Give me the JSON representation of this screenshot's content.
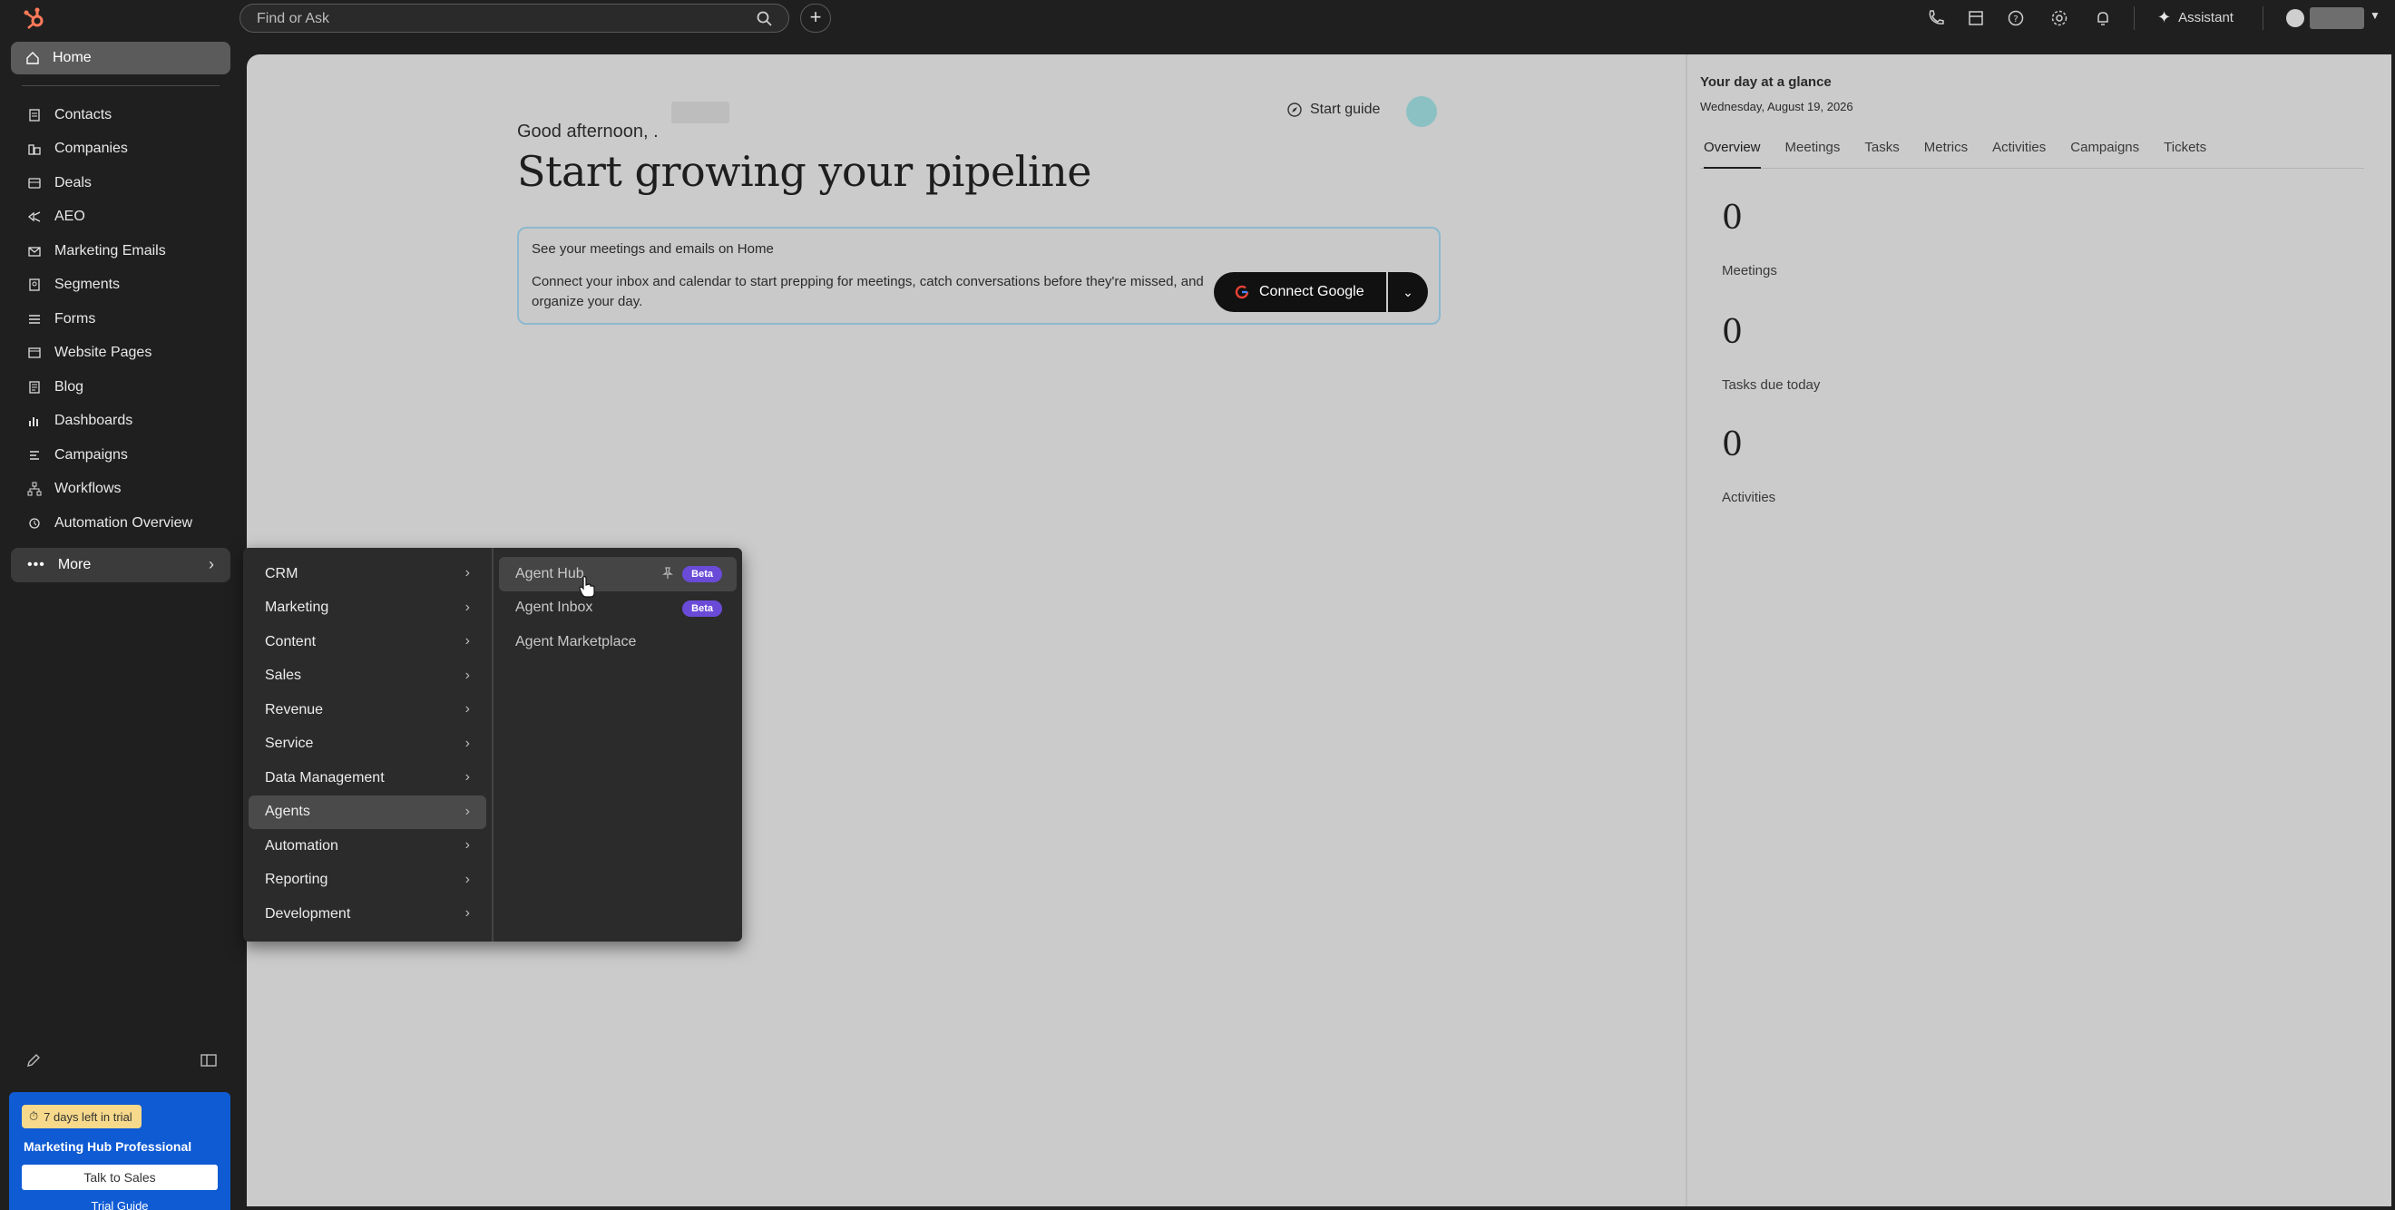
{
  "topbar": {
    "search_placeholder": "Find or Ask",
    "plus_label": "+",
    "assistant_label": "Assistant",
    "icons": [
      "phone-icon",
      "marketplace-icon",
      "help-icon",
      "settings-icon",
      "notifications-icon"
    ]
  },
  "sidebar": {
    "home_label": "Home",
    "items": [
      {
        "label": "Contacts",
        "icon": "contacts-icon"
      },
      {
        "label": "Companies",
        "icon": "companies-icon"
      },
      {
        "label": "Deals",
        "icon": "deals-icon"
      },
      {
        "label": "AEO",
        "icon": "aeo-icon"
      },
      {
        "label": "Marketing Emails",
        "icon": "email-icon"
      },
      {
        "label": "Segments",
        "icon": "segments-icon"
      },
      {
        "label": "Forms",
        "icon": "forms-icon"
      },
      {
        "label": "Website Pages",
        "icon": "website-icon"
      },
      {
        "label": "Blog",
        "icon": "blog-icon"
      },
      {
        "label": "Dashboards",
        "icon": "dashboards-icon"
      },
      {
        "label": "Campaigns",
        "icon": "campaigns-icon"
      },
      {
        "label": "Workflows",
        "icon": "workflows-icon"
      },
      {
        "label": "Automation Overview",
        "icon": "automation-icon"
      }
    ],
    "more_label": "More",
    "trial": {
      "badge": "7 days left in trial",
      "title": "Marketing Hub Professional",
      "button": "Talk to Sales",
      "link": "Trial Guide"
    }
  },
  "main": {
    "greeting": "Good afternoon, .",
    "start_guide": "Start guide",
    "title": "Start growing your pipeline",
    "connect_card": {
      "title": "See your meetings and emails on Home",
      "body": "Connect your inbox and calendar to start prepping for meetings, catch conversations before they're missed, and organize your day.",
      "button": "Connect Google"
    }
  },
  "glance": {
    "title": "Your day at a glance",
    "date": "Wednesday, August 19, 2026",
    "tabs": [
      "Overview",
      "Meetings",
      "Tasks",
      "Metrics",
      "Activities",
      "Campaigns",
      "Tickets"
    ],
    "active_tab": "Overview",
    "stats": [
      {
        "value": "0",
        "label": "Meetings"
      },
      {
        "value": "0",
        "label": "Tasks due today"
      },
      {
        "value": "0",
        "label": "Activities"
      }
    ]
  },
  "flyout": {
    "categories": [
      "CRM",
      "Marketing",
      "Content",
      "Sales",
      "Revenue",
      "Service",
      "Data Management",
      "Agents",
      "Automation",
      "Reporting",
      "Development"
    ],
    "active_category": "Agents",
    "sub_items": [
      {
        "label": "Agent Hub",
        "badge": "Beta"
      },
      {
        "label": "Agent Inbox",
        "badge": "Beta"
      },
      {
        "label": "Agent Marketplace",
        "badge": ""
      }
    ]
  },
  "colors": {
    "accent_blue": "#0f5bd4",
    "beta_purple": "#6a4bd8",
    "brand_orange": "#ff7a59",
    "trial_badge": "#f6d98a"
  }
}
